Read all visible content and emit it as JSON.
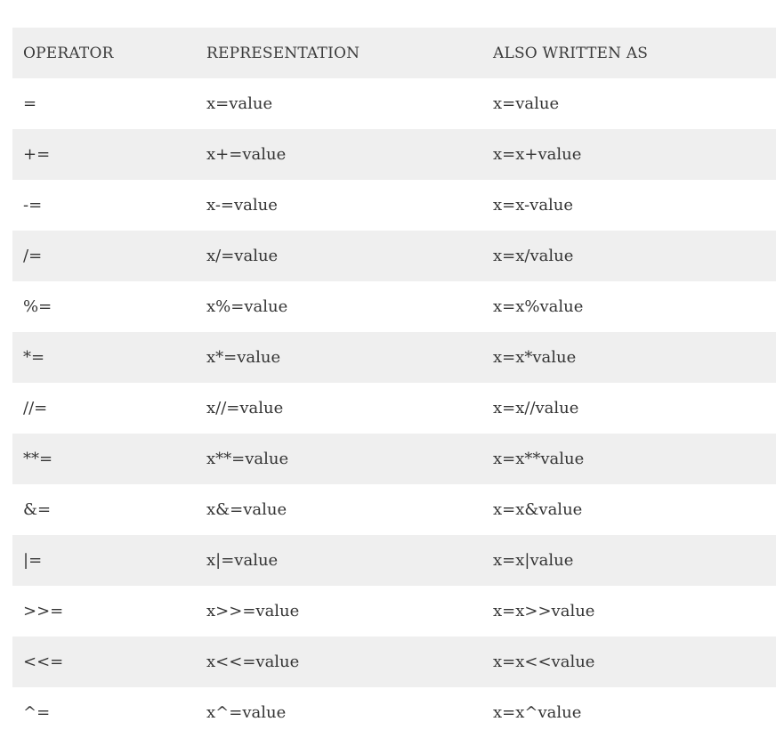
{
  "table": {
    "headers": [
      "OPERATOR",
      "REPRESENTATION",
      "ALSO WRITTEN AS"
    ],
    "rows": [
      [
        "=",
        "x=value",
        "x=value"
      ],
      [
        "+=",
        "x+=value",
        "x=x+value"
      ],
      [
        "-=",
        "x-=value",
        "x=x-value"
      ],
      [
        "/=",
        "x/=value",
        "x=x/value"
      ],
      [
        "%=",
        "x%=value",
        "x=x%value"
      ],
      [
        "*=",
        "x*=value",
        "x=x*value"
      ],
      [
        "//=",
        "x//=value",
        "x=x//value"
      ],
      [
        "**=",
        "x**=value",
        "x=x**value"
      ],
      [
        "&=",
        "x&=value",
        "x=x&value"
      ],
      [
        "|=",
        "x|=value",
        "x=x|value"
      ],
      [
        ">>=",
        "x>>=value",
        "x=x>>value"
      ],
      [
        "<<=",
        "x<<=value",
        "x=x<<value"
      ],
      [
        "^=",
        "x^=value",
        "x=x^value"
      ]
    ]
  },
  "colors": {
    "stripe": "#efefef",
    "background": "#ffffff",
    "text": "#333333"
  }
}
